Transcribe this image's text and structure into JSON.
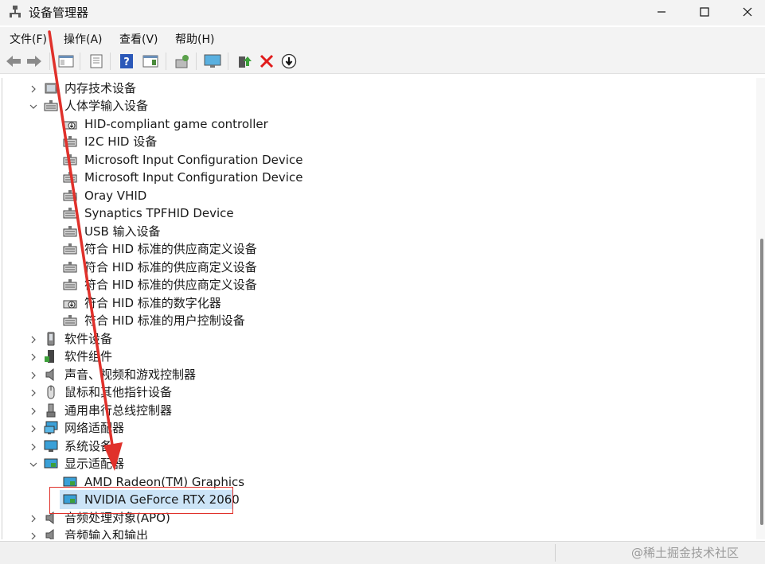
{
  "window": {
    "title": "设备管理器",
    "controls": [
      "minimize",
      "maximize",
      "close"
    ]
  },
  "menu": [
    {
      "label": "文件(F)"
    },
    {
      "label": "操作(A)"
    },
    {
      "label": "查看(V)"
    },
    {
      "label": "帮助(H)"
    }
  ],
  "toolbar": {
    "buttons": [
      "back-icon",
      "forward-icon",
      "show-hide-console-tree-icon",
      "properties-icon",
      "help-icon",
      "action-pane-icon",
      "scan-hardware-icon",
      "monitor-icon",
      "update-driver-icon",
      "uninstall-icon",
      "disable-device-icon"
    ]
  },
  "tree": {
    "items": [
      {
        "label": "内存技术设备",
        "level": 0,
        "expanded": false,
        "icon": "memory-icon"
      },
      {
        "label": "人体学输入设备",
        "level": 0,
        "expanded": true,
        "icon": "hid-icon"
      },
      {
        "label": "HID-compliant game controller",
        "level": 1,
        "icon": "hid-download-icon"
      },
      {
        "label": "I2C HID 设备",
        "level": 1,
        "icon": "hid-icon"
      },
      {
        "label": "Microsoft Input Configuration Device",
        "level": 1,
        "icon": "hid-icon"
      },
      {
        "label": "Microsoft Input Configuration Device",
        "level": 1,
        "icon": "hid-icon"
      },
      {
        "label": "Oray VHID",
        "level": 1,
        "icon": "hid-icon"
      },
      {
        "label": "Synaptics TPFHID Device",
        "level": 1,
        "icon": "hid-icon"
      },
      {
        "label": "USB 输入设备",
        "level": 1,
        "icon": "hid-icon"
      },
      {
        "label": "符合 HID 标准的供应商定义设备",
        "level": 1,
        "icon": "hid-icon"
      },
      {
        "label": "符合 HID 标准的供应商定义设备",
        "level": 1,
        "icon": "hid-icon"
      },
      {
        "label": "符合 HID 标准的供应商定义设备",
        "level": 1,
        "icon": "hid-icon"
      },
      {
        "label": "符合 HID 标准的数字化器",
        "level": 1,
        "icon": "hid-download-icon"
      },
      {
        "label": "符合 HID 标准的用户控制设备",
        "level": 1,
        "icon": "hid-icon"
      },
      {
        "label": "软件设备",
        "level": 0,
        "expanded": false,
        "icon": "software-device-icon"
      },
      {
        "label": "软件组件",
        "level": 0,
        "expanded": false,
        "icon": "software-component-icon"
      },
      {
        "label": "声音、视频和游戏控制器",
        "level": 0,
        "expanded": false,
        "icon": "speaker-icon"
      },
      {
        "label": "鼠标和其他指针设备",
        "level": 0,
        "expanded": false,
        "icon": "mouse-icon"
      },
      {
        "label": "通用串行总线控制器",
        "level": 0,
        "expanded": false,
        "icon": "usb-icon"
      },
      {
        "label": "网络适配器",
        "level": 0,
        "expanded": false,
        "icon": "network-icon"
      },
      {
        "label": "系统设备",
        "level": 0,
        "expanded": false,
        "icon": "system-device-icon"
      },
      {
        "label": "显示适配器",
        "level": 0,
        "expanded": true,
        "icon": "display-adapter-icon"
      },
      {
        "label": "AMD Radeon(TM) Graphics",
        "level": 1,
        "icon": "display-adapter-icon"
      },
      {
        "label": "NVIDIA GeForce RTX 2060",
        "level": 1,
        "icon": "display-adapter-icon",
        "selected": true
      },
      {
        "label": "音频处理对象(APO)",
        "level": 0,
        "expanded": false,
        "icon": "speaker-icon"
      },
      {
        "label": "音频输入和输出",
        "level": 0,
        "expanded": false,
        "icon": "speaker-icon"
      }
    ]
  },
  "watermark": "@稀土掘金技术社区",
  "colors": {
    "annotation": "#e0312b",
    "chrome": "#f3f3f3"
  }
}
